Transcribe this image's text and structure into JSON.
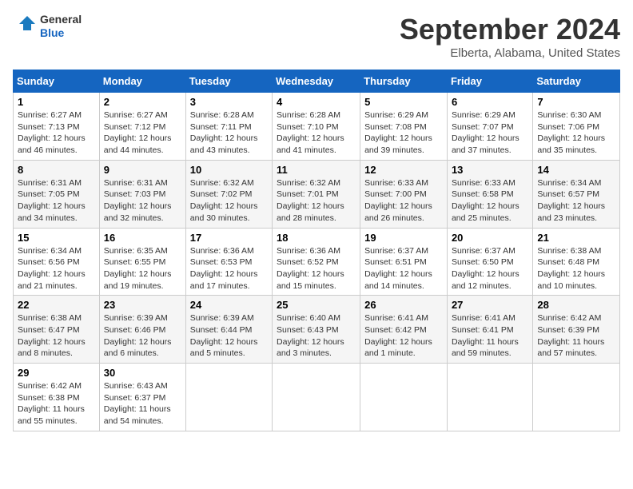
{
  "logo": {
    "line1": "General",
    "line2": "Blue"
  },
  "title": "September 2024",
  "subtitle": "Elberta, Alabama, United States",
  "days_of_week": [
    "Sunday",
    "Monday",
    "Tuesday",
    "Wednesday",
    "Thursday",
    "Friday",
    "Saturday"
  ],
  "weeks": [
    [
      {
        "day": "1",
        "sunrise": "Sunrise: 6:27 AM",
        "sunset": "Sunset: 7:13 PM",
        "daylight": "Daylight: 12 hours and 46 minutes."
      },
      {
        "day": "2",
        "sunrise": "Sunrise: 6:27 AM",
        "sunset": "Sunset: 7:12 PM",
        "daylight": "Daylight: 12 hours and 44 minutes."
      },
      {
        "day": "3",
        "sunrise": "Sunrise: 6:28 AM",
        "sunset": "Sunset: 7:11 PM",
        "daylight": "Daylight: 12 hours and 43 minutes."
      },
      {
        "day": "4",
        "sunrise": "Sunrise: 6:28 AM",
        "sunset": "Sunset: 7:10 PM",
        "daylight": "Daylight: 12 hours and 41 minutes."
      },
      {
        "day": "5",
        "sunrise": "Sunrise: 6:29 AM",
        "sunset": "Sunset: 7:08 PM",
        "daylight": "Daylight: 12 hours and 39 minutes."
      },
      {
        "day": "6",
        "sunrise": "Sunrise: 6:29 AM",
        "sunset": "Sunset: 7:07 PM",
        "daylight": "Daylight: 12 hours and 37 minutes."
      },
      {
        "day": "7",
        "sunrise": "Sunrise: 6:30 AM",
        "sunset": "Sunset: 7:06 PM",
        "daylight": "Daylight: 12 hours and 35 minutes."
      }
    ],
    [
      {
        "day": "8",
        "sunrise": "Sunrise: 6:31 AM",
        "sunset": "Sunset: 7:05 PM",
        "daylight": "Daylight: 12 hours and 34 minutes."
      },
      {
        "day": "9",
        "sunrise": "Sunrise: 6:31 AM",
        "sunset": "Sunset: 7:03 PM",
        "daylight": "Daylight: 12 hours and 32 minutes."
      },
      {
        "day": "10",
        "sunrise": "Sunrise: 6:32 AM",
        "sunset": "Sunset: 7:02 PM",
        "daylight": "Daylight: 12 hours and 30 minutes."
      },
      {
        "day": "11",
        "sunrise": "Sunrise: 6:32 AM",
        "sunset": "Sunset: 7:01 PM",
        "daylight": "Daylight: 12 hours and 28 minutes."
      },
      {
        "day": "12",
        "sunrise": "Sunrise: 6:33 AM",
        "sunset": "Sunset: 7:00 PM",
        "daylight": "Daylight: 12 hours and 26 minutes."
      },
      {
        "day": "13",
        "sunrise": "Sunrise: 6:33 AM",
        "sunset": "Sunset: 6:58 PM",
        "daylight": "Daylight: 12 hours and 25 minutes."
      },
      {
        "day": "14",
        "sunrise": "Sunrise: 6:34 AM",
        "sunset": "Sunset: 6:57 PM",
        "daylight": "Daylight: 12 hours and 23 minutes."
      }
    ],
    [
      {
        "day": "15",
        "sunrise": "Sunrise: 6:34 AM",
        "sunset": "Sunset: 6:56 PM",
        "daylight": "Daylight: 12 hours and 21 minutes."
      },
      {
        "day": "16",
        "sunrise": "Sunrise: 6:35 AM",
        "sunset": "Sunset: 6:55 PM",
        "daylight": "Daylight: 12 hours and 19 minutes."
      },
      {
        "day": "17",
        "sunrise": "Sunrise: 6:36 AM",
        "sunset": "Sunset: 6:53 PM",
        "daylight": "Daylight: 12 hours and 17 minutes."
      },
      {
        "day": "18",
        "sunrise": "Sunrise: 6:36 AM",
        "sunset": "Sunset: 6:52 PM",
        "daylight": "Daylight: 12 hours and 15 minutes."
      },
      {
        "day": "19",
        "sunrise": "Sunrise: 6:37 AM",
        "sunset": "Sunset: 6:51 PM",
        "daylight": "Daylight: 12 hours and 14 minutes."
      },
      {
        "day": "20",
        "sunrise": "Sunrise: 6:37 AM",
        "sunset": "Sunset: 6:50 PM",
        "daylight": "Daylight: 12 hours and 12 minutes."
      },
      {
        "day": "21",
        "sunrise": "Sunrise: 6:38 AM",
        "sunset": "Sunset: 6:48 PM",
        "daylight": "Daylight: 12 hours and 10 minutes."
      }
    ],
    [
      {
        "day": "22",
        "sunrise": "Sunrise: 6:38 AM",
        "sunset": "Sunset: 6:47 PM",
        "daylight": "Daylight: 12 hours and 8 minutes."
      },
      {
        "day": "23",
        "sunrise": "Sunrise: 6:39 AM",
        "sunset": "Sunset: 6:46 PM",
        "daylight": "Daylight: 12 hours and 6 minutes."
      },
      {
        "day": "24",
        "sunrise": "Sunrise: 6:39 AM",
        "sunset": "Sunset: 6:44 PM",
        "daylight": "Daylight: 12 hours and 5 minutes."
      },
      {
        "day": "25",
        "sunrise": "Sunrise: 6:40 AM",
        "sunset": "Sunset: 6:43 PM",
        "daylight": "Daylight: 12 hours and 3 minutes."
      },
      {
        "day": "26",
        "sunrise": "Sunrise: 6:41 AM",
        "sunset": "Sunset: 6:42 PM",
        "daylight": "Daylight: 12 hours and 1 minute."
      },
      {
        "day": "27",
        "sunrise": "Sunrise: 6:41 AM",
        "sunset": "Sunset: 6:41 PM",
        "daylight": "Daylight: 11 hours and 59 minutes."
      },
      {
        "day": "28",
        "sunrise": "Sunrise: 6:42 AM",
        "sunset": "Sunset: 6:39 PM",
        "daylight": "Daylight: 11 hours and 57 minutes."
      }
    ],
    [
      {
        "day": "29",
        "sunrise": "Sunrise: 6:42 AM",
        "sunset": "Sunset: 6:38 PM",
        "daylight": "Daylight: 11 hours and 55 minutes."
      },
      {
        "day": "30",
        "sunrise": "Sunrise: 6:43 AM",
        "sunset": "Sunset: 6:37 PM",
        "daylight": "Daylight: 11 hours and 54 minutes."
      },
      null,
      null,
      null,
      null,
      null
    ]
  ]
}
